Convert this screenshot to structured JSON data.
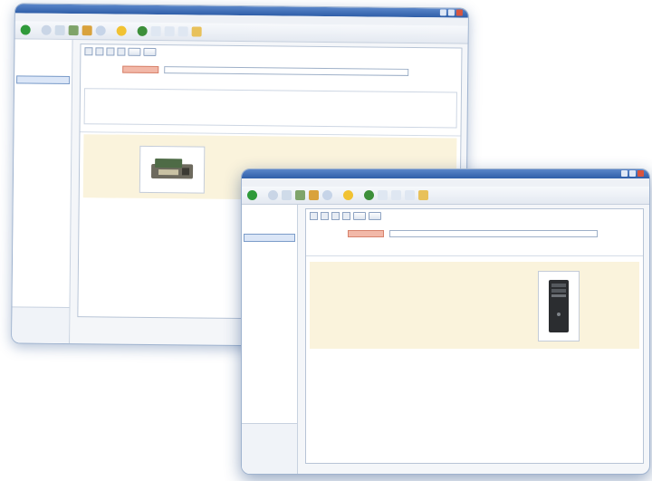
{
  "back_window": {
    "title": "",
    "menu": [],
    "toolbar": {
      "back_label": "",
      "search_label": "",
      "favorites_label": ""
    },
    "sidebar": {
      "selector": "",
      "items": []
    },
    "tabs": [],
    "actions": {
      "save": "",
      "new": ""
    },
    "header_field": {
      "label": "",
      "code": "",
      "value": ""
    },
    "subtabs": [],
    "fields": [],
    "section_title": "",
    "fields2": [],
    "image_caption": "",
    "status_items": []
  },
  "front_window": {
    "title": "",
    "menu": [],
    "toolbar": {
      "back_label": "",
      "search_label": "",
      "favorites_label": ""
    },
    "sidebar": {
      "selector": "",
      "items": [],
      "bottom_items": []
    },
    "tabs": [],
    "actions": {
      "save": "",
      "new": ""
    },
    "header_field": {
      "label": "",
      "code": "",
      "value": ""
    },
    "subtabs_row1": [],
    "subtabs_row2": [],
    "section_title": "",
    "left_fields": [],
    "right_fields": [],
    "lower_fields": []
  },
  "colors": {
    "titlebar": "#2f5ea8",
    "accent_field": "#f2b8a8",
    "selection": "#dbe6f7"
  }
}
